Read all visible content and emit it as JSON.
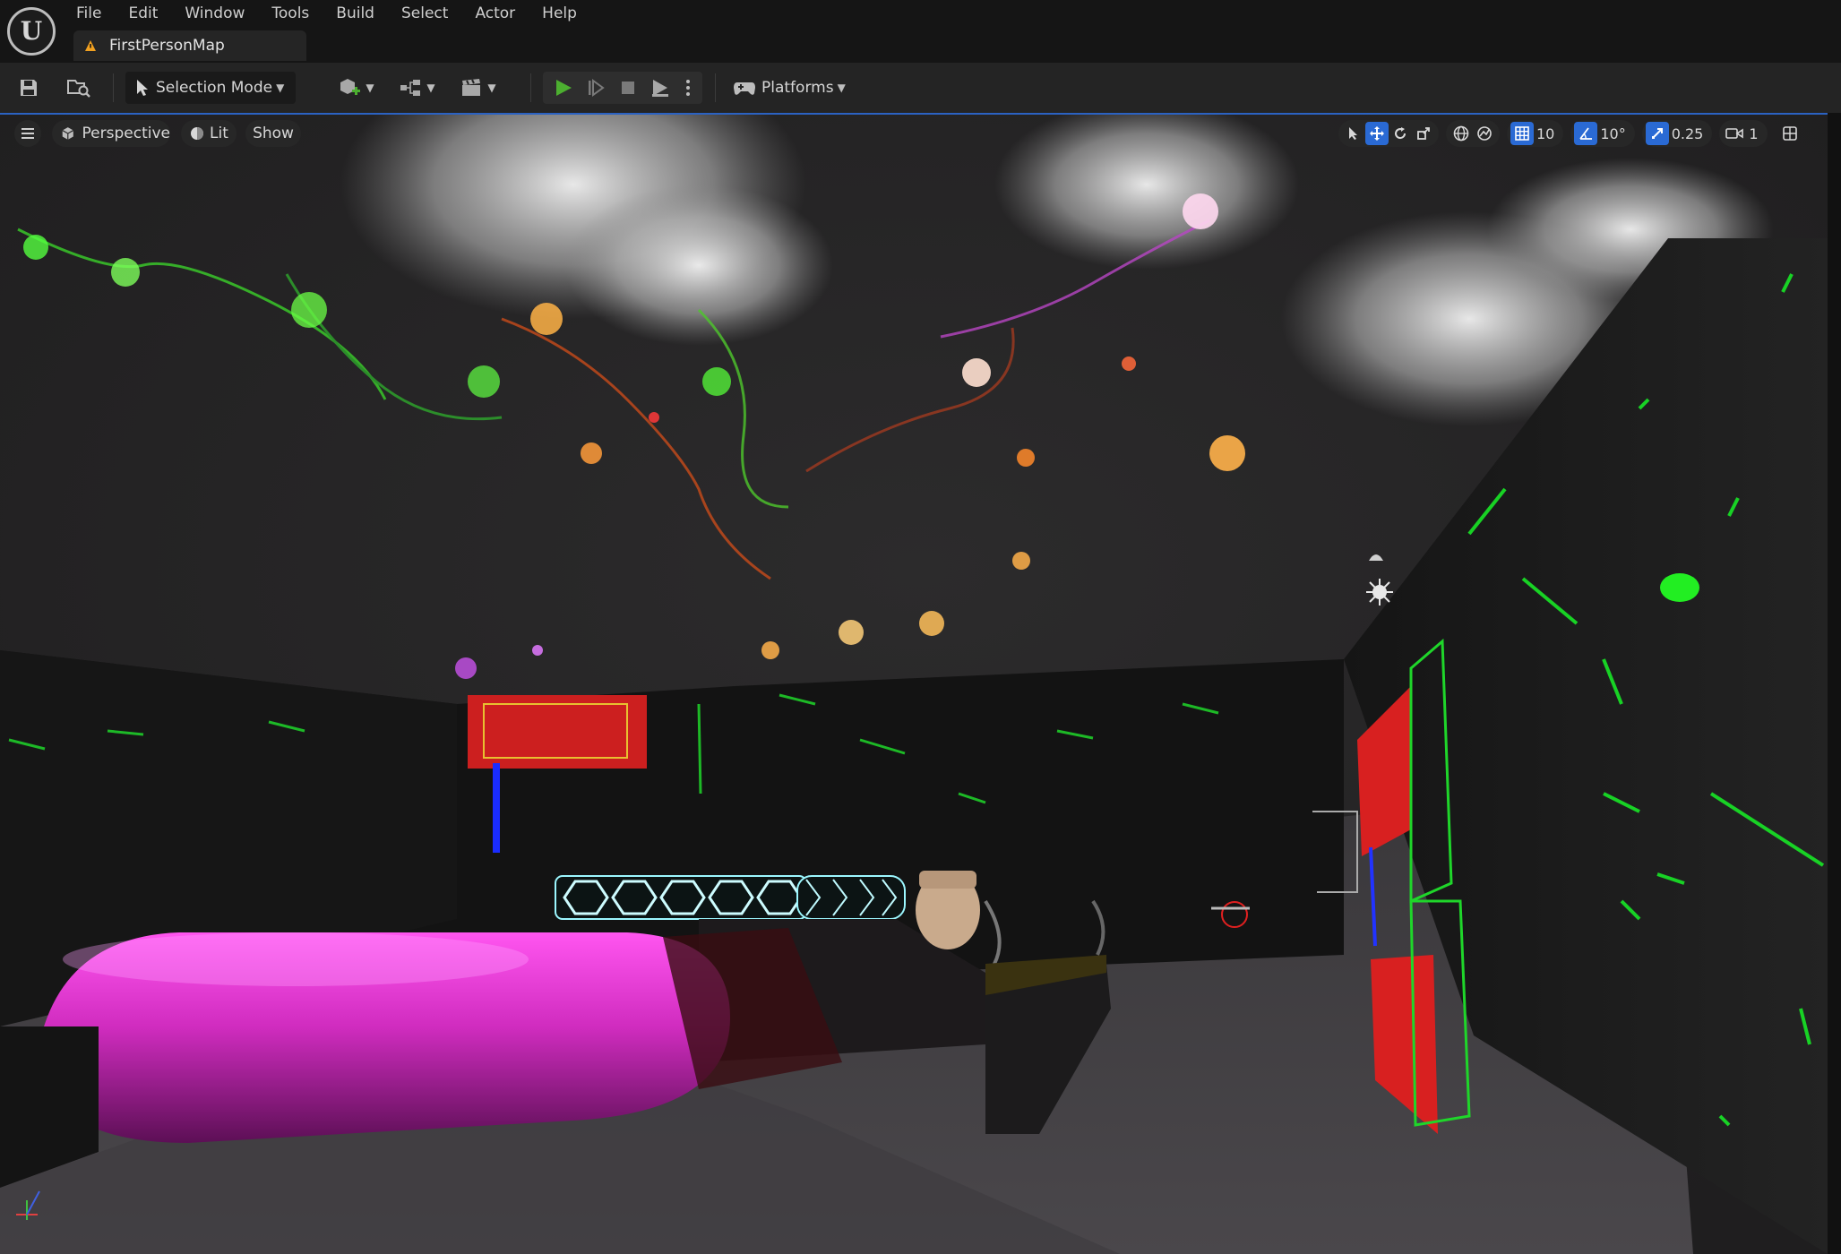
{
  "menu": {
    "items": [
      {
        "label": "File"
      },
      {
        "label": "Edit"
      },
      {
        "label": "Window"
      },
      {
        "label": "Tools"
      },
      {
        "label": "Build"
      },
      {
        "label": "Select"
      },
      {
        "label": "Actor"
      },
      {
        "label": "Help"
      }
    ]
  },
  "tab": {
    "map_name": "FirstPersonMap"
  },
  "toolbar": {
    "selection_mode": "Selection Mode",
    "platforms": "Platforms"
  },
  "viewport": {
    "perspective": "Perspective",
    "lit": "Lit",
    "show": "Show",
    "grid_snap": "10",
    "rotation_snap": "10°",
    "scale_snap": "0.25",
    "camera_speed": "1"
  },
  "colors": {
    "accent": "#2a6ad4",
    "play_green": "#4caf30",
    "warning": "#f0a020"
  }
}
